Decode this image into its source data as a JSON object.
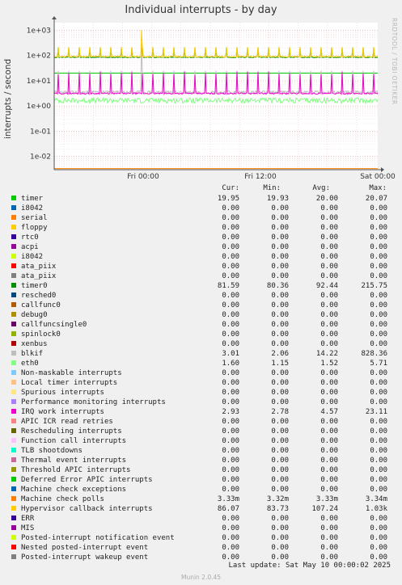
{
  "chart_data": {
    "type": "line",
    "title": "Individual interrupts - by day",
    "ylabel": "interrupts / second",
    "yscale": "log",
    "ylim": [
      0.003,
      2000
    ],
    "ytick_labels": [
      "1e+03",
      "1e+02",
      "1e+01",
      "1e+00",
      "1e-01",
      "1e-02"
    ],
    "ytick_values": [
      1000,
      100,
      10,
      1,
      0.1,
      0.01
    ],
    "xtick_labels": [
      "Fri 00:00",
      "Fri 12:00",
      "Sat 00:00"
    ],
    "watermark": "RRDTOOL / TOBI OETIKER",
    "series": [
      {
        "name": "timer",
        "color": "#00cc00",
        "cur": "19.95",
        "min": "19.93",
        "avg": "20.00",
        "max": "20.07"
      },
      {
        "name": "i8042",
        "color": "#0066b3",
        "cur": "0.00",
        "min": "0.00",
        "avg": "0.00",
        "max": "0.00"
      },
      {
        "name": "serial",
        "color": "#ff8000",
        "cur": "0.00",
        "min": "0.00",
        "avg": "0.00",
        "max": "0.00"
      },
      {
        "name": "floppy",
        "color": "#ffcc00",
        "cur": "0.00",
        "min": "0.00",
        "avg": "0.00",
        "max": "0.00"
      },
      {
        "name": "rtc0",
        "color": "#330099",
        "cur": "0.00",
        "min": "0.00",
        "avg": "0.00",
        "max": "0.00"
      },
      {
        "name": "acpi",
        "color": "#990099",
        "cur": "0.00",
        "min": "0.00",
        "avg": "0.00",
        "max": "0.00"
      },
      {
        "name": "i8042",
        "color": "#ccff00",
        "cur": "0.00",
        "min": "0.00",
        "avg": "0.00",
        "max": "0.00"
      },
      {
        "name": "ata_piix",
        "color": "#ff0000",
        "cur": "0.00",
        "min": "0.00",
        "avg": "0.00",
        "max": "0.00"
      },
      {
        "name": "ata_piix",
        "color": "#808080",
        "cur": "0.00",
        "min": "0.00",
        "avg": "0.00",
        "max": "0.00"
      },
      {
        "name": "timer0",
        "color": "#008f00",
        "cur": "81.59",
        "min": "80.36",
        "avg": "92.44",
        "max": "215.75"
      },
      {
        "name": "resched0",
        "color": "#00487d",
        "cur": "0.00",
        "min": "0.00",
        "avg": "0.00",
        "max": "0.00"
      },
      {
        "name": "callfunc0",
        "color": "#b35a00",
        "cur": "0.00",
        "min": "0.00",
        "avg": "0.00",
        "max": "0.00"
      },
      {
        "name": "debug0",
        "color": "#b38f00",
        "cur": "0.00",
        "min": "0.00",
        "avg": "0.00",
        "max": "0.00"
      },
      {
        "name": "callfuncsingle0",
        "color": "#6b006b",
        "cur": "0.00",
        "min": "0.00",
        "avg": "0.00",
        "max": "0.00"
      },
      {
        "name": "spinlock0",
        "color": "#8fb300",
        "cur": "0.00",
        "min": "0.00",
        "avg": "0.00",
        "max": "0.00"
      },
      {
        "name": "xenbus",
        "color": "#b30000",
        "cur": "0.00",
        "min": "0.00",
        "avg": "0.00",
        "max": "0.00"
      },
      {
        "name": "blkif",
        "color": "#bebebe",
        "cur": "3.01",
        "min": "2.06",
        "avg": "14.22",
        "max": "828.36"
      },
      {
        "name": "eth0",
        "color": "#80ff80",
        "cur": "1.60",
        "min": "1.15",
        "avg": "1.52",
        "max": "5.71"
      },
      {
        "name": "Non-maskable interrupts",
        "color": "#80c9ff",
        "cur": "0.00",
        "min": "0.00",
        "avg": "0.00",
        "max": "0.00"
      },
      {
        "name": "Local timer interrupts",
        "color": "#ffc080",
        "cur": "0.00",
        "min": "0.00",
        "avg": "0.00",
        "max": "0.00"
      },
      {
        "name": "Spurious interrupts",
        "color": "#ffe680",
        "cur": "0.00",
        "min": "0.00",
        "avg": "0.00",
        "max": "0.00"
      },
      {
        "name": "Performance monitoring interrupts",
        "color": "#aa80ff",
        "cur": "0.00",
        "min": "0.00",
        "avg": "0.00",
        "max": "0.00"
      },
      {
        "name": "IRQ work interrupts",
        "color": "#ee00cc",
        "cur": "2.93",
        "min": "2.78",
        "avg": "4.57",
        "max": "23.11"
      },
      {
        "name": "APIC ICR read retries",
        "color": "#ff8080",
        "cur": "0.00",
        "min": "0.00",
        "avg": "0.00",
        "max": "0.00"
      },
      {
        "name": "Rescheduling interrupts",
        "color": "#666600",
        "cur": "0.00",
        "min": "0.00",
        "avg": "0.00",
        "max": "0.00"
      },
      {
        "name": "Function call interrupts",
        "color": "#ffbfff",
        "cur": "0.00",
        "min": "0.00",
        "avg": "0.00",
        "max": "0.00"
      },
      {
        "name": "TLB shootdowns",
        "color": "#00ffcc",
        "cur": "0.00",
        "min": "0.00",
        "avg": "0.00",
        "max": "0.00"
      },
      {
        "name": "Thermal event interrupts",
        "color": "#cc6699",
        "cur": "0.00",
        "min": "0.00",
        "avg": "0.00",
        "max": "0.00"
      },
      {
        "name": "Threshold APIC interrupts",
        "color": "#999900",
        "cur": "0.00",
        "min": "0.00",
        "avg": "0.00",
        "max": "0.00"
      },
      {
        "name": "Deferred Error APIC interrupts",
        "color": "#00cc00",
        "cur": "0.00",
        "min": "0.00",
        "avg": "0.00",
        "max": "0.00"
      },
      {
        "name": "Machine check exceptions",
        "color": "#0066b3",
        "cur": "0.00",
        "min": "0.00",
        "avg": "0.00",
        "max": "0.00"
      },
      {
        "name": "Machine check polls",
        "color": "#ff8000",
        "cur": "3.33m",
        "min": "3.32m",
        "avg": "3.33m",
        "max": "3.34m"
      },
      {
        "name": "Hypervisor callback interrupts",
        "color": "#ffcc00",
        "cur": "86.07",
        "min": "83.73",
        "avg": "107.24",
        "max": "1.03k"
      },
      {
        "name": "ERR",
        "color": "#330099",
        "cur": "0.00",
        "min": "0.00",
        "avg": "0.00",
        "max": "0.00"
      },
      {
        "name": "MIS",
        "color": "#990099",
        "cur": "0.00",
        "min": "0.00",
        "avg": "0.00",
        "max": "0.00"
      },
      {
        "name": "Posted-interrupt notification event",
        "color": "#ccff00",
        "cur": "0.00",
        "min": "0.00",
        "avg": "0.00",
        "max": "0.00"
      },
      {
        "name": "Nested posted-interrupt event",
        "color": "#ff0000",
        "cur": "0.00",
        "min": "0.00",
        "avg": "0.00",
        "max": "0.00"
      },
      {
        "name": "Posted-interrupt wakeup event",
        "color": "#808080",
        "cur": "0.00",
        "min": "0.00",
        "avg": "0.00",
        "max": "0.00"
      }
    ]
  },
  "legend_header": {
    "cur": "Cur:",
    "min": "Min:",
    "avg": "Avg:",
    "max": "Max:"
  },
  "last_update": "Last update: Sat May 10 00:00:02 2025",
  "footer": "Munin 2.0.45"
}
